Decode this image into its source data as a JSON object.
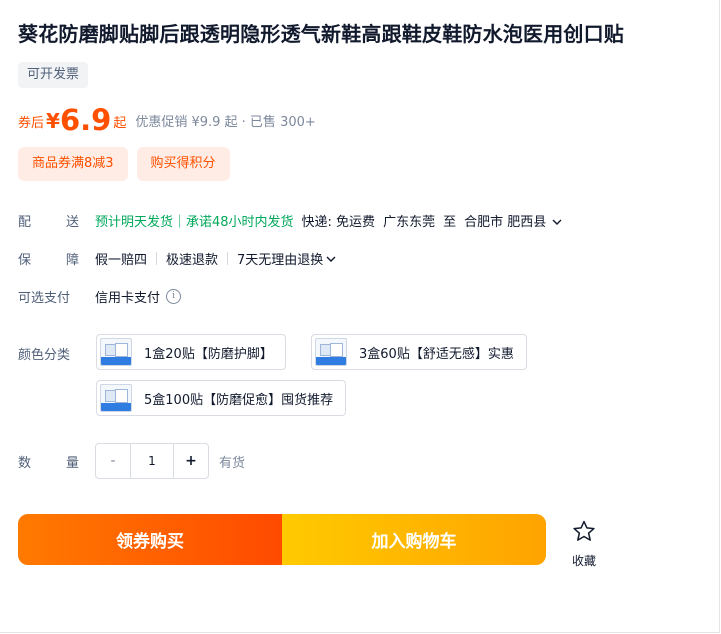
{
  "product": {
    "title": "葵花防磨脚贴脚后跟透明隐形透气新鞋高跟鞋皮鞋防水泡医用创口贴",
    "invoice_tag": "可开发票"
  },
  "price": {
    "coupon_prefix": "券后",
    "currency": "¥",
    "value": "6.9",
    "suffix": "起",
    "promo_text": "优惠促销 ¥9.9 起 · 已售 300+"
  },
  "tags": [
    "商品券满8减3",
    "购买得积分"
  ],
  "shipping": {
    "label": "配送",
    "delivery_promise": "预计明天发货｜承诺48小时内发货",
    "express": "快递: 免运费",
    "origin": "广东东莞",
    "to": "至",
    "destination": "合肥市 肥西县"
  },
  "guarantee": {
    "label": "保障",
    "items": [
      "假一赔四",
      "极速退款",
      "7天无理由退换"
    ]
  },
  "payment": {
    "label": "可选支付",
    "method": "信用卡支付",
    "info_icon": "i"
  },
  "color_options": {
    "label": "颜色分类",
    "options": [
      "1盒20贴【防磨护脚】",
      "3盒60贴【舒适无感】实惠",
      "5盒100贴【防磨促愈】囤货推荐"
    ]
  },
  "quantity": {
    "label": "数量",
    "minus": "-",
    "value": "1",
    "plus": "+",
    "stock": "有货"
  },
  "actions": {
    "buy_label": "领券购买",
    "cart_label": "加入购物车",
    "favorite_label": "收藏"
  },
  "colors": {
    "accent": "#ff5000",
    "delivery_green": "#00a85a",
    "tag_bg": "#ffece4"
  }
}
